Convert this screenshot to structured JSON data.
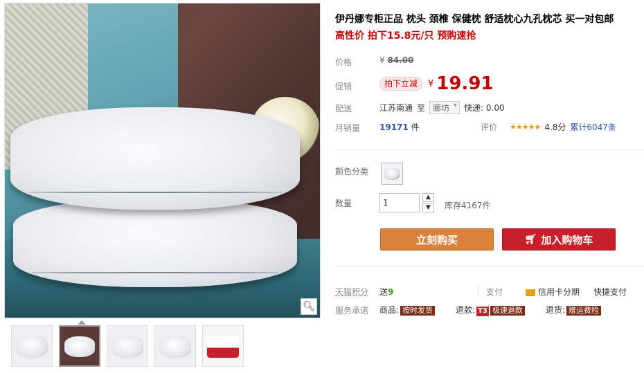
{
  "product": {
    "title": "伊丹娜专柜正品 枕头 颈椎 保健枕 舒适枕心九孔枕芯 买一对包邮",
    "subtitle": "高性价 拍下15.8元/只 预购速抢"
  },
  "price": {
    "label": "价格",
    "currency": "¥",
    "original": "84.00"
  },
  "promo": {
    "label": "促销",
    "tag": "拍下立减",
    "currency": "¥",
    "value": "19.91"
  },
  "shipping": {
    "label": "配送",
    "from": "江苏南通",
    "to_word": "至",
    "destination": "廊坊",
    "express": "快递: 0.00"
  },
  "sales": {
    "label": "月销量",
    "count": "19171",
    "unit": "件",
    "rating_label": "评价",
    "stars": "★★★★★",
    "score": "4.8分",
    "total_reviews": "累计6047条"
  },
  "options": {
    "color_label": "颜色分类",
    "quantity_label": "数量",
    "quantity_value": "1",
    "stock": "库存4167件",
    "qty_up": "▲",
    "qty_down": "▼"
  },
  "actions": {
    "buy_now": "立刻购买",
    "add_to_cart": "加入购物车"
  },
  "extras": {
    "points_label": "天猫积分",
    "points_send": "送",
    "points_value": "9",
    "pay_label": "支付",
    "credit_installment": "信用卡分期",
    "quick_pay": "快捷支付",
    "service_label": "服务承诺",
    "goods_label": "商品:",
    "goods_badge": "按时发货",
    "refund_label": "退款:",
    "refund_t3": "T3",
    "refund_badge": "极速退款",
    "return_label": "退货:",
    "return_badge": "赠运费险"
  },
  "icons": {
    "zoom": "search-icon",
    "cart": "cart-icon",
    "credit": "credit-card-icon"
  },
  "colors": {
    "accent_red": "#c40000",
    "buy_orange": "#d9823d",
    "cart_red": "#c8202b",
    "link_blue": "#2e58a6"
  }
}
